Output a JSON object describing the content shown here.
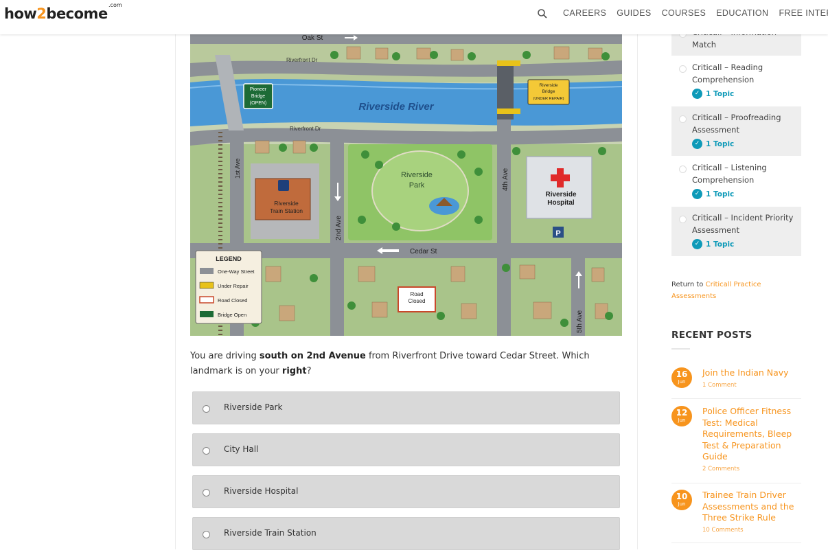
{
  "header": {
    "logo_pre": "how",
    "logo_two": "2",
    "logo_post": "become",
    "logo_com": ".com",
    "nav": [
      "CAREERS",
      "GUIDES",
      "COURSES",
      "EDUCATION",
      "FREE INTERVIEW"
    ]
  },
  "map": {
    "streets": {
      "oak": "Oak St",
      "riverfront_top": "Riverfront Dr",
      "riverfront_bottom": "Riverfront Dr",
      "first": "1st Ave",
      "second": "2nd Ave",
      "fourth": "4th Ave",
      "fifth": "5th Ave",
      "cedar": "Cedar St"
    },
    "river": "Riverside River",
    "pioneer_bridge": [
      "Pioneer",
      "Bridge",
      "(OPEN)"
    ],
    "riverside_bridge": [
      "Riverside",
      "Bridge",
      "(UNDER REPAIR)"
    ],
    "park": [
      "Riverside",
      "Park"
    ],
    "hospital": [
      "Riverside",
      "Hospital"
    ],
    "parking": "P",
    "train_station": [
      "Riverside",
      "Train Station"
    ],
    "road_closed": [
      "Road",
      "Closed"
    ],
    "legend": {
      "title": "LEGEND",
      "items": [
        "One-Way Street",
        "Under Repair",
        "Road Closed",
        "Bridge Open"
      ]
    }
  },
  "question": {
    "pre": "You are driving ",
    "b1": "south on 2nd Avenue",
    "mid": " from Riverfront Drive toward Cedar Street. Which landmark is on your ",
    "b2": "right",
    "post": "?"
  },
  "answers": [
    "Riverside Park",
    "City Hall",
    "Riverside Hospital",
    "Riverside Train Station"
  ],
  "sidebar": {
    "items": [
      {
        "title": "Criticall – Information Match",
        "topic": ""
      },
      {
        "title": "Criticall – Reading Comprehension",
        "topic": "1 Topic"
      },
      {
        "title": "Criticall – Proofreading Assessment",
        "topic": "1 Topic"
      },
      {
        "title": "Criticall – Listening Comprehension",
        "topic": "1 Topic"
      },
      {
        "title": "Criticall – Incident Priority Assessment",
        "topic": "1 Topic"
      }
    ],
    "return_pre": "Return to ",
    "return_link": "Criticall Practice Assessments"
  },
  "recent_posts": {
    "title": "RECENT POSTS",
    "posts": [
      {
        "day": "16",
        "month": "Jun",
        "title": "Join the Indian Navy",
        "comments": "1 Comment"
      },
      {
        "day": "12",
        "month": "Jun",
        "title": "Police Officer Fitness Test: Medical Requirements, Bleep Test & Preparation Guide",
        "comments": "2 Comments"
      },
      {
        "day": "10",
        "month": "Jun",
        "title": "Trainee Train Driver Assessments and the Three Strike Rule",
        "comments": "10 Comments"
      }
    ]
  },
  "colors": {
    "brand": "#f7941d",
    "teal": "#0e9ab8",
    "river": "#4a98d6",
    "grass": "#8fc466",
    "road": "#8c9096"
  }
}
